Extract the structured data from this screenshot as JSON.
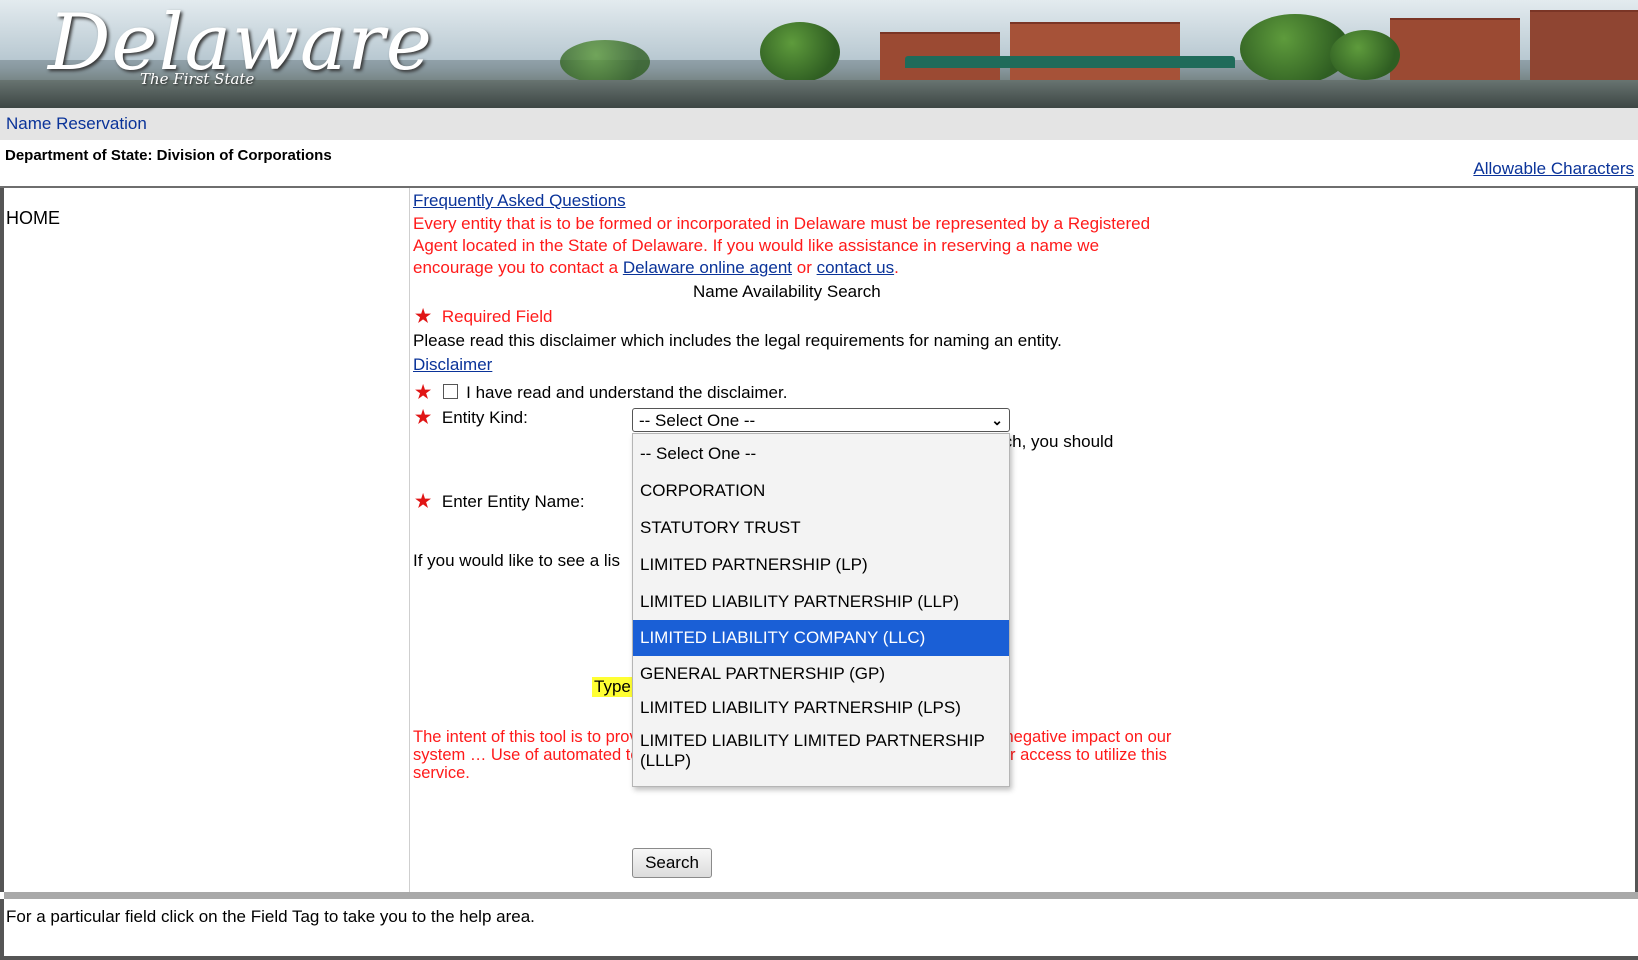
{
  "banner": {
    "logo_text": "Delaware",
    "tagline": "The First State"
  },
  "header": {
    "app_title": "Name Reservation",
    "department": "Department of State: Division of Corporations",
    "allowable_link": "Allowable Characters"
  },
  "sidebar": {
    "home": "HOME"
  },
  "main": {
    "faq_link": "Frequently Asked Questions",
    "intro_text": "Every entity that is to be formed or incorporated in Delaware must be represented by a Registered Agent located in the State of Delaware. If you would like assistance in reserving a name we encourage you to contact a",
    "agent_link": "Delaware online agent",
    "or_text": "or",
    "contact_link": "contact us",
    "period": ".",
    "section_title": "Name Availability Search",
    "required_label": "Required Field",
    "disclaimer_note": "Please read this disclaimer which includes the legal requirements for naming an entity.",
    "disclaimer_link": "Disclaimer",
    "agree_label": "I have read and understand the disclaimer.",
    "entity_kind_label": "Entity Kind:",
    "entity_name_label": "Enter Entity Name:",
    "list_note_partial": "If you would like to see a lis",
    "behind_note_partial": "rch, you should",
    "type_highlight": "Type",
    "warning_text": "The intent of this tool is to provide … Division of Corporations strictly prohibits … negative impact on our system … Use of automated tools in any form may result in the suspension of your access to utilize this service.",
    "search_button": "Search"
  },
  "entity_select": {
    "selected_value": "-- Select One --",
    "options": [
      "-- Select One --",
      "CORPORATION",
      "STATUTORY TRUST",
      "LIMITED PARTNERSHIP (LP)",
      "LIMITED LIABILITY PARTNERSHIP (LLP)",
      "LIMITED LIABILITY COMPANY (LLC)",
      "GENERAL PARTNERSHIP (GP)",
      "LIMITED LIABILITY PARTNERSHIP (LPS)",
      "LIMITED LIABILITY LIMITED PARTNERSHIP (LLLP)"
    ],
    "highlighted_index": 5,
    "highlight_color": "#1a5fd6"
  },
  "footer": {
    "help_text": "For a particular field click on the Field Tag to take you to the help area."
  },
  "colors": {
    "link": "#0a3399",
    "warning": "#ff1a1a",
    "highlight": "#ffff33"
  }
}
